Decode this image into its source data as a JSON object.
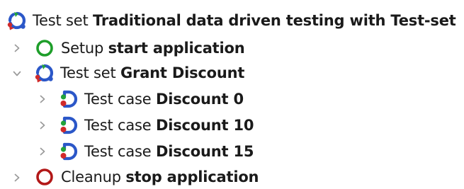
{
  "tree": {
    "root": {
      "kind": "Test set",
      "name": "Traditional data driven testing with Test-set",
      "icon": "test-set-icon"
    },
    "items": [
      {
        "kind": "Setup",
        "name": "start application",
        "icon": "setup-icon",
        "expanded": false
      },
      {
        "kind": "Test set",
        "name": "Grant Discount",
        "icon": "test-set-icon",
        "expanded": true,
        "children": [
          {
            "kind": "Test case",
            "name": "Discount 0",
            "icon": "test-case-icon",
            "expanded": false
          },
          {
            "kind": "Test case",
            "name": "Discount 10",
            "icon": "test-case-icon",
            "expanded": false
          },
          {
            "kind": "Test case",
            "name": "Discount 15",
            "icon": "test-case-icon",
            "expanded": false
          }
        ]
      },
      {
        "kind": "Cleanup",
        "name": "stop application",
        "icon": "cleanup-icon",
        "expanded": false
      }
    ]
  },
  "colors": {
    "setup_green": "#1e9e2a",
    "cleanup_red": "#b21818",
    "loop_blue": "#2b57c8",
    "loop_red": "#d02a2a",
    "loop_green": "#22a33a",
    "arrow_gray": "#9a9a9a"
  }
}
